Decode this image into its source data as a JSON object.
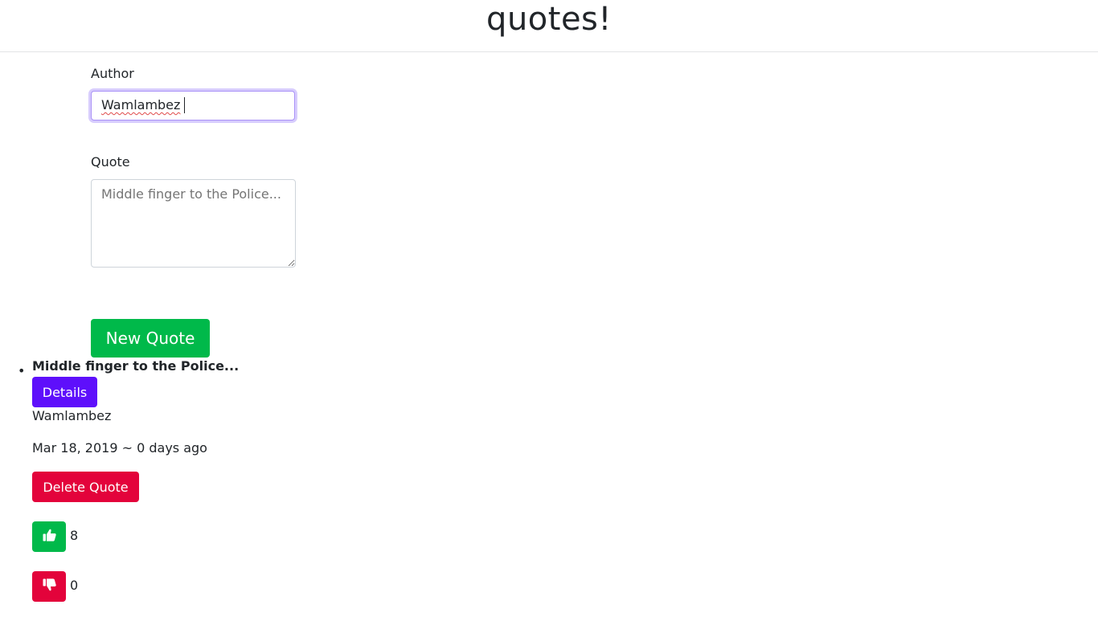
{
  "header": {
    "title": "quotes!"
  },
  "form": {
    "author_label": "Author",
    "author_value": "Wamlambez",
    "quote_label": "Quote",
    "quote_placeholder": "Middle finger to the Police...",
    "submit_label": "New Quote"
  },
  "quotes": [
    {
      "text": "Middle finger to the Police...",
      "details_label": "Details",
      "author": "Wamlambez",
      "date": "Mar 18, 2019 ~ 0 days ago",
      "delete_label": "Delete Quote",
      "upvotes": "8",
      "downvotes": "0"
    }
  ],
  "icons": {
    "upvote": "thumbs-up-icon",
    "downvote": "thumbs-down-icon"
  },
  "colors": {
    "green": "#00b94a",
    "purple": "#5e0ffb",
    "red": "#e3033b"
  }
}
